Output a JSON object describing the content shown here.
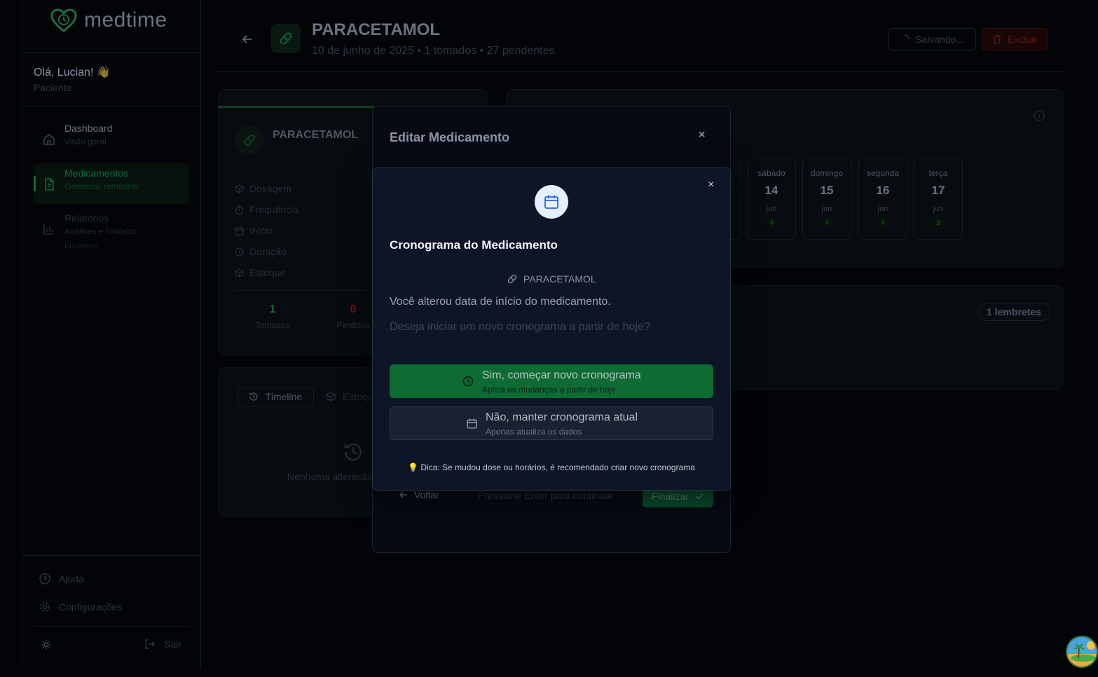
{
  "app": {
    "name": "medtime"
  },
  "user": {
    "greeting": "Olá, Lucian!",
    "wave": "👋",
    "role": "Paciente"
  },
  "nav": [
    {
      "title": "Dashboard",
      "subtitle": "Visão geral"
    },
    {
      "title": "Medicamentos",
      "subtitle": "Gerenciar remédios"
    },
    {
      "title": "Relatórios",
      "subtitle": "Análises e histórico",
      "note": "Em breve"
    }
  ],
  "sidebar_bottom": {
    "help": "Ajuda",
    "settings": "Configurações",
    "logout": "Sair"
  },
  "header": {
    "title": "PARACETAMOL",
    "subtitle": "10 de junho de 2025 • 1 tomados • 27 pendentes",
    "saving_label": "Salvando...",
    "delete_label": "Excluir"
  },
  "med_card": {
    "title": "PARACETAMOL",
    "details": [
      "Dosagem",
      "Frequência",
      "Início",
      "Duração",
      "Estoque"
    ],
    "stats": [
      {
        "value": "1",
        "label": "Tomados",
        "color": "#0e6b34"
      },
      {
        "value": "0",
        "label": "Perdidos",
        "color": "#6b1515"
      }
    ]
  },
  "history_card": {
    "tabs": [
      "Timeline",
      "Estoque"
    ],
    "empty": "Nenhuma alteração"
  },
  "schedule": {
    "days": [
      {
        "weekday": "sábado",
        "day": "14",
        "month": "jun",
        "count": "4"
      },
      {
        "weekday": "domingo",
        "day": "15",
        "month": "jun",
        "count": "4"
      },
      {
        "weekday": "segunda",
        "day": "16",
        "month": "jun",
        "count": "4"
      },
      {
        "weekday": "terça",
        "day": "17",
        "month": "jun",
        "count": "3"
      }
    ]
  },
  "reminders": {
    "badge": "1 lembretes"
  },
  "edit_modal": {
    "title": "Editar Medicamento",
    "close": "×",
    "back": "Voltar",
    "hint": "Pressione Enter para continuar",
    "finish": "Finalizar"
  },
  "dialog": {
    "close": "×",
    "title": "Cronograma do Medicamento",
    "medication": "PARACETAMOL",
    "message": "Você alterou data de início do medicamento.",
    "question": "Deseja iniciar um novo cronograma a partir de hoje?",
    "yes": {
      "label": "Sim, começar novo cronograma",
      "sub": "Aplica as mudanças a partir de hoje"
    },
    "no": {
      "label": "Não, manter cronograma atual",
      "sub": "Apenas atualiza os dados"
    },
    "tip_icon": "💡",
    "tip": "Dica: Se mudou dose ou horários, é recomendado criar novo cronograma"
  },
  "colors": {
    "accent": "#0e6b34",
    "dialog_bg": "#0d1526",
    "danger": "#6b1515"
  }
}
